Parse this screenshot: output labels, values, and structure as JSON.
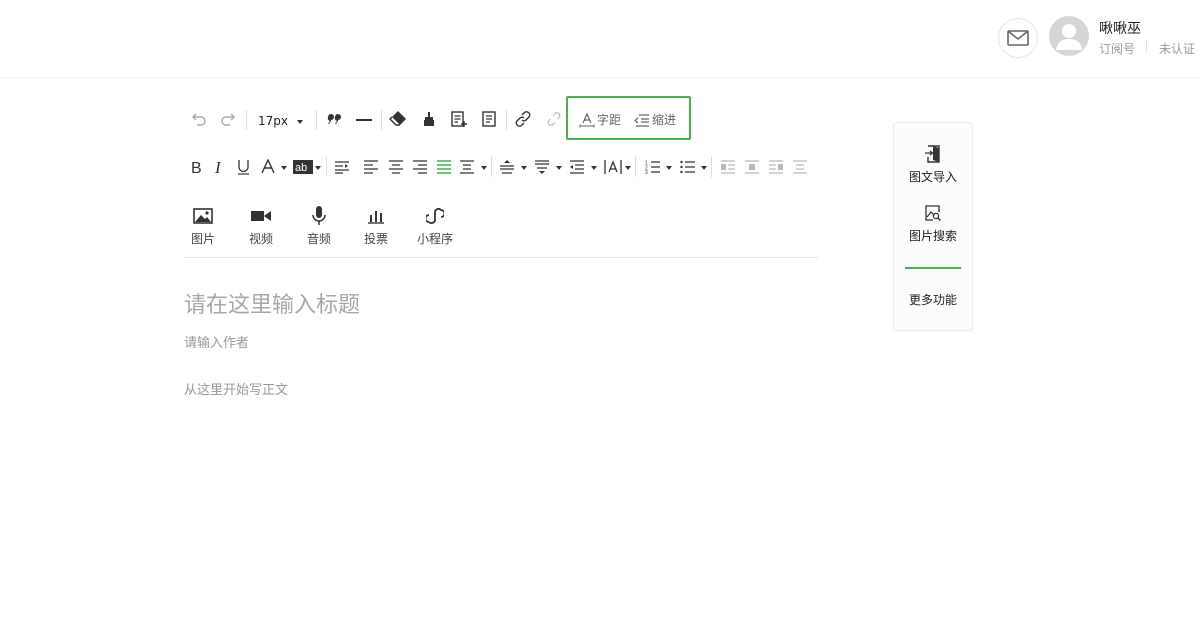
{
  "header": {
    "user_name": "啾啾巫",
    "account_type": "订阅号",
    "verify_status": "未认证"
  },
  "toolbar": {
    "font_size": "17px",
    "letter_spacing_label": "字距",
    "indent_label": "缩进",
    "icons": [
      "undo-icon",
      "redo-icon",
      "quote-icon",
      "horizontal-rule-icon",
      "eraser-icon",
      "format-painter-icon",
      "insert-template-icon",
      "template-icon",
      "link-icon",
      "unlink-icon",
      "bold-icon",
      "italic-icon",
      "underline-icon",
      "font-color-icon",
      "background-color-icon",
      "text-direction-icon",
      "align-left-icon",
      "align-center-icon",
      "align-right-icon",
      "align-justify-icon",
      "distribute-icon",
      "line-height-icon",
      "paragraph-spacing-icon",
      "outdent-icon",
      "letter-case-icon",
      "ordered-list-icon",
      "unordered-list-icon",
      "float-left-icon",
      "float-center-icon",
      "float-right-icon",
      "float-none-icon"
    ]
  },
  "media": {
    "image": "图片",
    "video": "视频",
    "audio": "音频",
    "vote": "投票",
    "mini_program": "小程序"
  },
  "editor": {
    "title_placeholder": "请在这里输入标题",
    "author_placeholder": "请输入作者",
    "body_placeholder": "从这里开始写正文"
  },
  "side_panel": {
    "import_label": "图文导入",
    "image_search_label": "图片搜索",
    "more_label": "更多功能",
    "accent": "#4caf50"
  }
}
